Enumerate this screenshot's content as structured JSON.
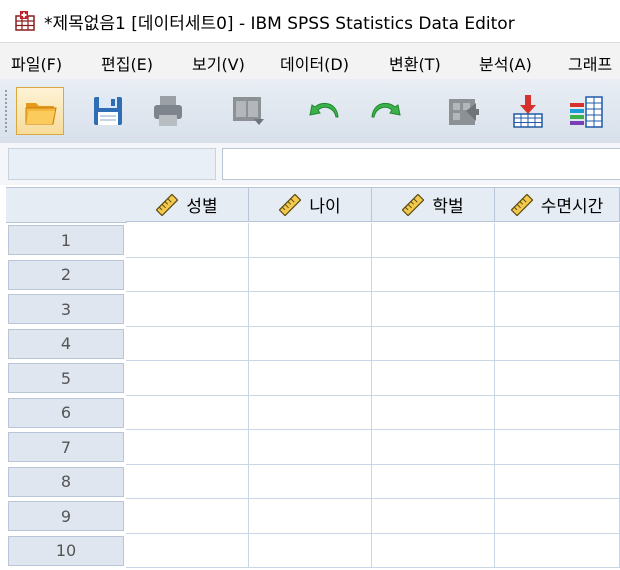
{
  "window": {
    "title": "*제목없음1 [데이터세트0] - IBM SPSS Statistics Data Editor"
  },
  "menu": [
    {
      "label": "파일(F)"
    },
    {
      "label": "편집(E)"
    },
    {
      "label": "보기(V)"
    },
    {
      "label": "데이터(D)"
    },
    {
      "label": "변환(T)"
    },
    {
      "label": "분석(A)"
    },
    {
      "label": "그래프"
    }
  ],
  "toolbar": [
    {
      "icon": "open-folder-icon"
    },
    {
      "icon": "save-floppy-icon"
    },
    {
      "icon": "print-icon"
    },
    {
      "icon": "dialog-recall-icon"
    },
    {
      "icon": "undo-icon"
    },
    {
      "icon": "redo-icon"
    },
    {
      "icon": "goto-case-icon"
    },
    {
      "icon": "goto-variable-icon"
    },
    {
      "icon": "variables-icon"
    }
  ],
  "cell_editor": {
    "reference": "",
    "value": ""
  },
  "grid": {
    "columns": [
      {
        "label": "성별",
        "icon": "scale-ruler-icon"
      },
      {
        "label": "나이",
        "icon": "scale-ruler-icon"
      },
      {
        "label": "학벌",
        "icon": "scale-ruler-icon"
      },
      {
        "label": "수면시간",
        "icon": "scale-ruler-icon"
      }
    ],
    "rows": [
      "1",
      "2",
      "3",
      "4",
      "5",
      "6",
      "7",
      "8",
      "9",
      "10"
    ]
  },
  "colors": {
    "header_bg": "#e6ecf4",
    "grid_line": "#c9d6e6",
    "toolbar_active": "#f7dc9a"
  }
}
